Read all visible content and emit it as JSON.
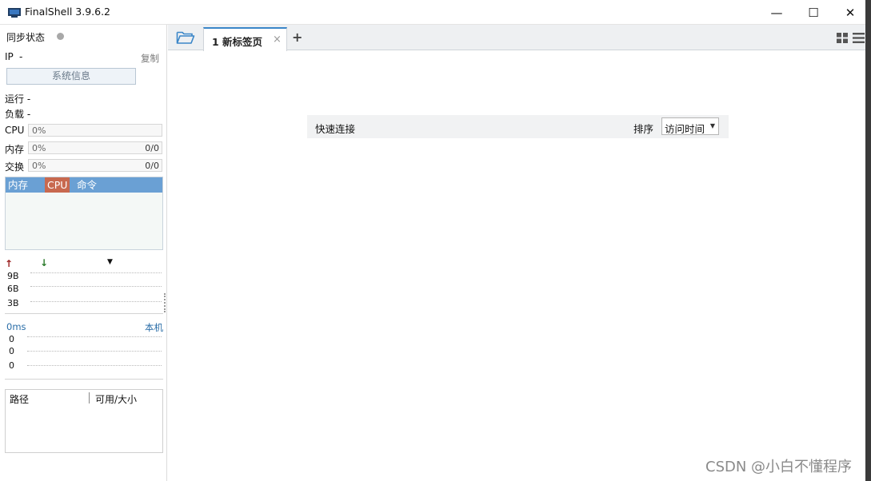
{
  "window": {
    "title": "FinalShell 3.9.6.2",
    "minimize_glyph": "—",
    "maximize_glyph": "☐",
    "close_glyph": "✕"
  },
  "left_panel": {
    "sync_status_label": "同步状态",
    "ip_label": "IP",
    "ip_value": "-",
    "copy_label": "复制",
    "sysinfo_button": "系统信息",
    "uptime_label": "运行 -",
    "load_label": "负载 -",
    "meters": [
      {
        "label": "CPU",
        "percent": "0%",
        "ratio": ""
      },
      {
        "label": "内存",
        "percent": "0%",
        "ratio": "0/0"
      },
      {
        "label": "交换",
        "percent": "0%",
        "ratio": "0/0"
      }
    ],
    "process_tabs": [
      "内存",
      "CPU",
      "命令"
    ],
    "network": {
      "up_arrow": "↑",
      "down_arrow": "↓",
      "dropdown_glyph": "▼",
      "y_labels": [
        "9B",
        "6B",
        "3B"
      ]
    },
    "ping": {
      "latency": "0ms",
      "host": "本机",
      "y_labels": [
        "0",
        "0",
        "0"
      ]
    },
    "disk": {
      "columns": [
        "路径",
        "可用/大小"
      ]
    }
  },
  "tabs": {
    "items": [
      {
        "label": "1 新标签页",
        "close": "×"
      }
    ],
    "add_glyph": "+"
  },
  "main": {
    "quick_connect_label": "快速连接",
    "sort_label": "排序",
    "sort_value": "访问时间",
    "sort_caret": "▼"
  },
  "watermark": "CSDN @小白不懂程序",
  "colors": {
    "accent": "#3a86c8",
    "process_header": "#6aa0d4",
    "cpu_tab": "#c8694f",
    "link": "#2b6ea8"
  }
}
